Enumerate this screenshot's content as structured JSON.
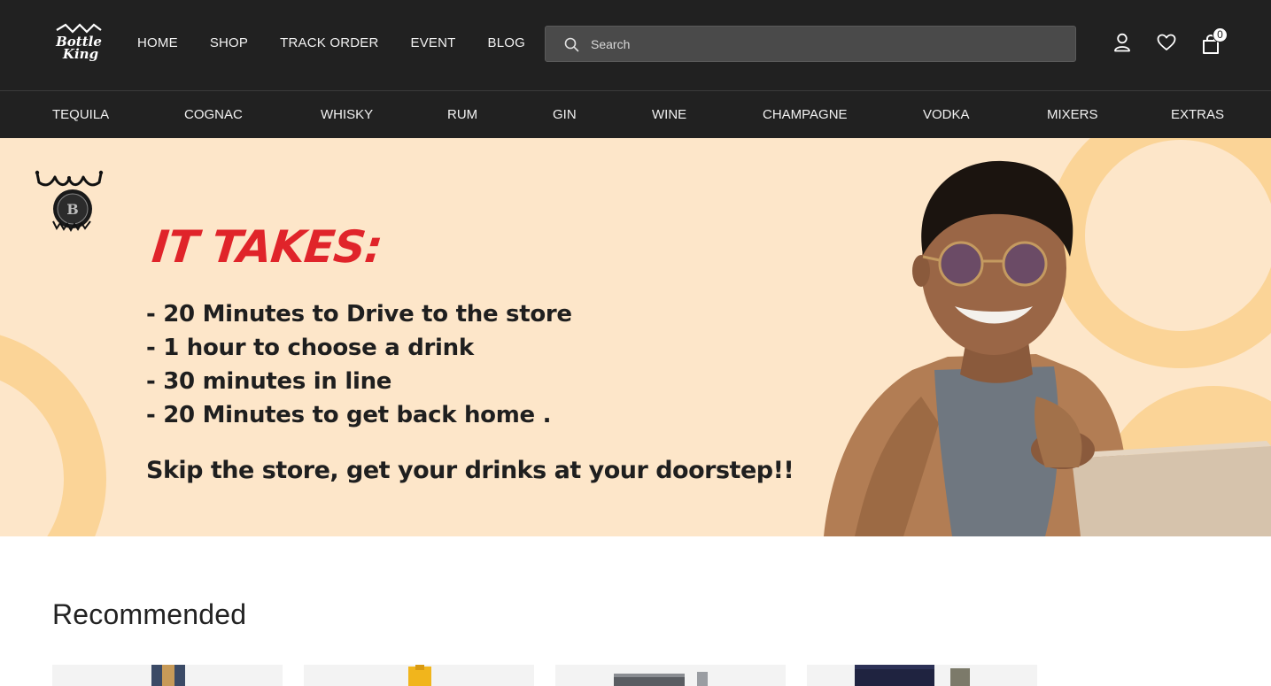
{
  "header": {
    "logo_alt": "Bottle King",
    "nav": [
      "HOME",
      "SHOP",
      "TRACK ORDER",
      "EVENT",
      "BLOG"
    ],
    "search_placeholder": "Search",
    "cart_count": "0"
  },
  "categories": [
    "TEQUILA",
    "COGNAC",
    "WHISKY",
    "RUM",
    "GIN",
    "WINE",
    "CHAMPAGNE",
    "VODKA",
    "MIXERS",
    "EXTRAS"
  ],
  "banner": {
    "headline": "IT TAKES:",
    "lines": [
      "- 20 Minutes to Drive to the store",
      "- 1 hour to choose a drink",
      "- 30 minutes in line",
      "- 20 Minutes to get back home ."
    ],
    "tagline": "Skip the store, get your drinks at your doorstep!!"
  },
  "recommended": {
    "title": "Recommended"
  },
  "colors": {
    "header_bg": "#212121",
    "banner_bg": "#fde6c9",
    "banner_accent": "#fbd497",
    "headline_red": "#e0242a"
  }
}
